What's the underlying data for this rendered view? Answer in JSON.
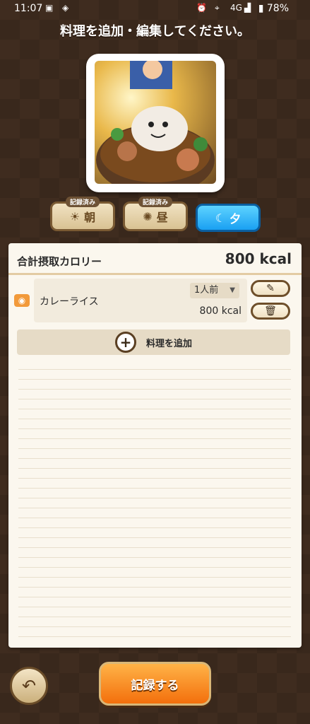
{
  "status_bar": {
    "time": "11:07",
    "network": "4G",
    "battery": "78%"
  },
  "header": {
    "title": "料理を追加・編集してください。"
  },
  "meal_tabs": [
    {
      "label": "朝",
      "tag": "記録済み",
      "icon": "sunrise-icon",
      "active": false
    },
    {
      "label": "昼",
      "tag": "記録済み",
      "icon": "sun-icon",
      "active": false
    },
    {
      "label": "夕",
      "tag": "",
      "icon": "moon-icon",
      "active": true
    }
  ],
  "summary": {
    "total_label": "合計摂取カロリー",
    "total_value": "800 kcal"
  },
  "food_items": [
    {
      "name": "カレーライス",
      "portion": "1人前",
      "kcal": "800 kcal"
    }
  ],
  "actions": {
    "add_dish_label": "料理を追加",
    "record_label": "記録する"
  },
  "colors": {
    "background": "#3f2c1f",
    "active_tab": "#1aa0f2",
    "record_button": "#f36f0c",
    "panel": "#fbf7ee"
  }
}
